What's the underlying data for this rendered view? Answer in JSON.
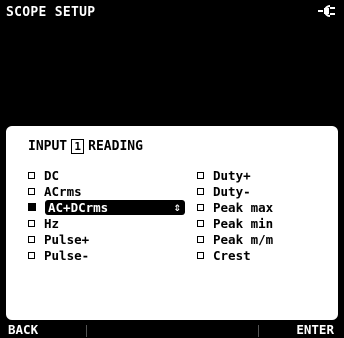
{
  "title": "SCOPE SETUP",
  "status_icon": "power-plug-icon",
  "dialog": {
    "heading_prefix": "INPUT",
    "channel": "1",
    "heading_suffix": "READING",
    "left_options": [
      "DC",
      "ACrms",
      "AC+DCrms",
      "Hz",
      "Pulse+",
      "Pulse-"
    ],
    "right_options": [
      "Duty+",
      "Duty-",
      "Peak max",
      "Peak min",
      "Peak m/m",
      "Crest"
    ],
    "selected": "AC+DCrms",
    "selected_spinner": "⇕"
  },
  "softkeys": {
    "back": "BACK",
    "enter": "ENTER"
  },
  "colors": {
    "background": "#000000",
    "panel": "#ffffff",
    "text_light": "#ffffff",
    "text_dark": "#000000"
  }
}
